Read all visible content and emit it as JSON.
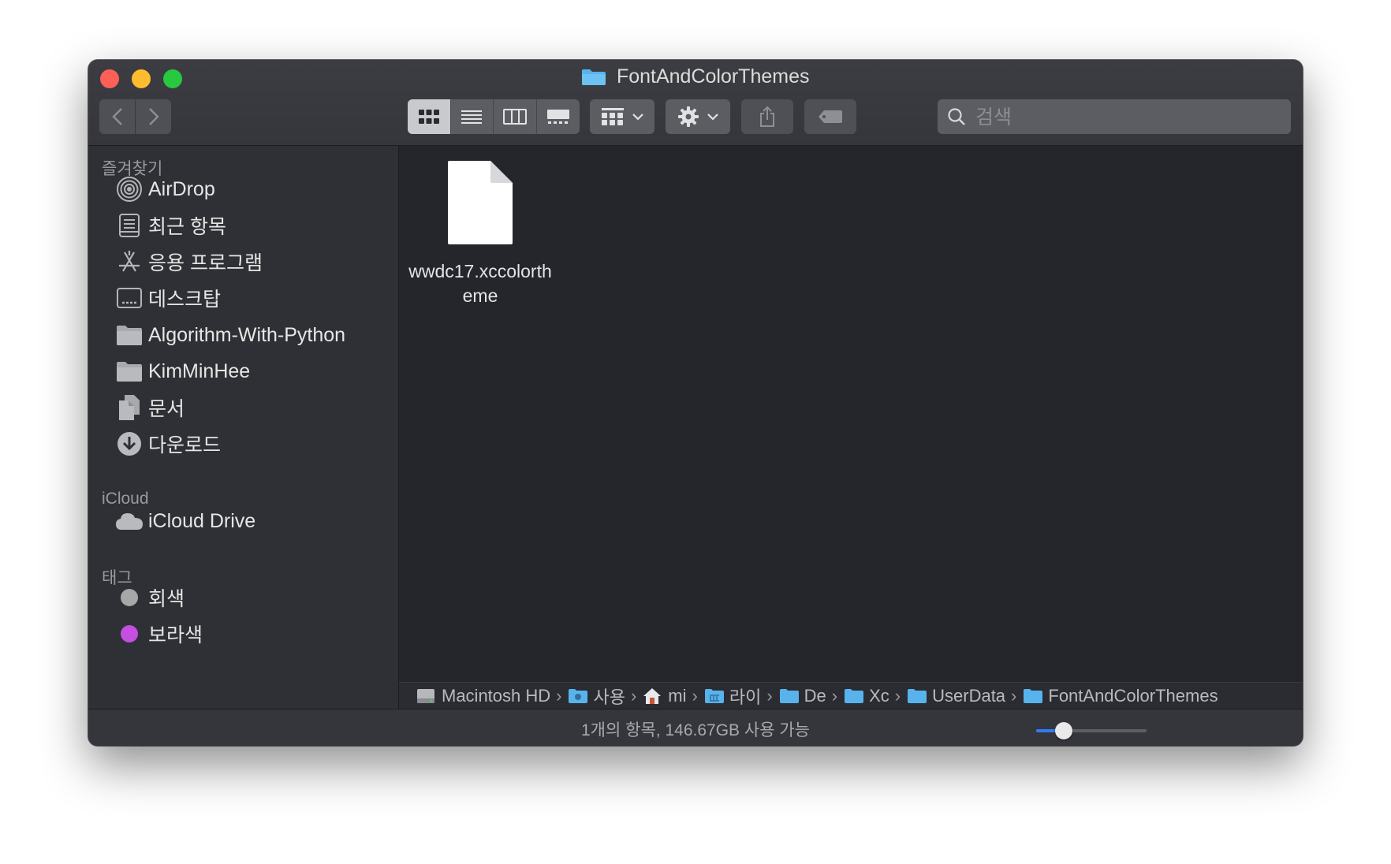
{
  "window": {
    "title": "FontAndColorThemes",
    "title_icon": "folder-icon"
  },
  "toolbar": {
    "back_icon": "chevron-left-icon",
    "forward_icon": "chevron-right-icon",
    "view_modes": [
      {
        "name": "icon-view",
        "icon": "grid-icon",
        "active": true
      },
      {
        "name": "list-view",
        "icon": "list-icon",
        "active": false
      },
      {
        "name": "column-view",
        "icon": "columns-icon",
        "active": false
      },
      {
        "name": "gallery-view",
        "icon": "gallery-icon",
        "active": false
      }
    ],
    "group_icon": "group-grid-icon",
    "action_icon": "gear-icon",
    "share_icon": "share-icon",
    "tag_icon": "tag-icon",
    "search_placeholder": "검색"
  },
  "sidebar": {
    "favorites_label": "즐겨찾기",
    "favorites": [
      {
        "label": "AirDrop",
        "icon": "airdrop-icon"
      },
      {
        "label": "최근 항목",
        "icon": "recents-icon"
      },
      {
        "label": "응용 프로그램",
        "icon": "applications-icon"
      },
      {
        "label": "데스크탑",
        "icon": "desktop-icon"
      },
      {
        "label": "Algorithm-With-Python",
        "icon": "folder-icon"
      },
      {
        "label": "KimMinHee",
        "icon": "folder-icon"
      },
      {
        "label": "문서",
        "icon": "documents-icon"
      },
      {
        "label": "다운로드",
        "icon": "downloads-icon"
      }
    ],
    "icloud_label": "iCloud",
    "icloud": [
      {
        "label": "iCloud Drive",
        "icon": "cloud-icon"
      }
    ],
    "tags_label": "태그",
    "tags": [
      {
        "label": "회색",
        "color": "#a7a7aa"
      },
      {
        "label": "보라색",
        "color": "#c44fe0"
      }
    ]
  },
  "content": {
    "files": [
      {
        "name": "wwdc17.xccolortheme",
        "icon": "document-icon"
      }
    ]
  },
  "pathbar": {
    "crumbs": [
      {
        "label": "Macintosh HD",
        "icon": "harddisk-icon"
      },
      {
        "label": "사용",
        "icon": "users-folder-icon"
      },
      {
        "label": "mi",
        "icon": "home-icon"
      },
      {
        "label": "라이",
        "icon": "library-folder-icon"
      },
      {
        "label": "De",
        "icon": "folder-icon"
      },
      {
        "label": "Xc",
        "icon": "folder-icon"
      },
      {
        "label": "UserData",
        "icon": "folder-icon"
      },
      {
        "label": "FontAndColorThemes",
        "icon": "folder-icon"
      }
    ]
  },
  "status": {
    "text": "1개의 항목, 146.67GB 사용 가능",
    "icon_size_fraction": 0.25
  },
  "colors": {
    "window_bg": "#2b2c31",
    "sidebar_bg": "#2f3035",
    "content_bg": "#24262c",
    "folder_blue": "#58b3ec",
    "accent": "#2f7bf5"
  }
}
